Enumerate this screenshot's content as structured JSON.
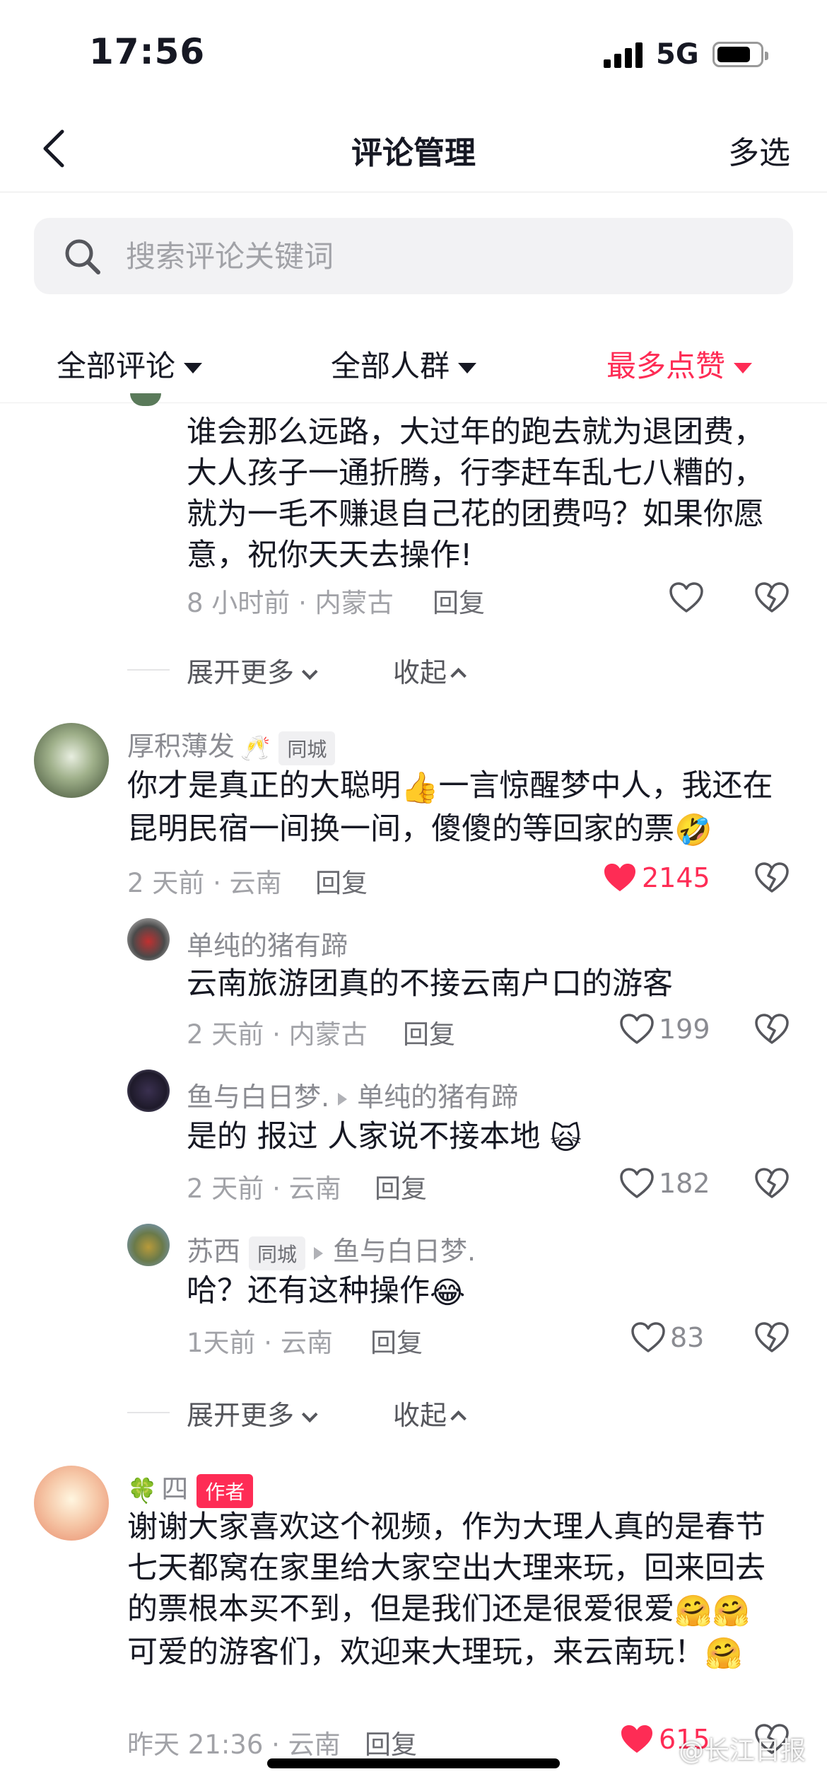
{
  "status_bar": {
    "time": "17:56",
    "network": "5G"
  },
  "header": {
    "title": "评论管理",
    "multi_select": "多选"
  },
  "search": {
    "placeholder": "搜索评论关键词"
  },
  "filters": {
    "all_comments": "全部评论",
    "all_people": "全部人群",
    "most_liked": "最多点赞"
  },
  "colors": {
    "accent": "#fe2c55",
    "text": "#161823",
    "secondary": "#8a8b91"
  },
  "comments": {
    "c0": {
      "text": "谁会那么远路，大过年的跑去就为退团费，大人孩子一通折腾，行李赶车乱七八糟的，就为一毛不赚退自己花的团费吗？如果你愿意，祝你天天去操作!",
      "meta": "8 小时前 · 内蒙古",
      "reply": "回复"
    },
    "expand1": {
      "more": "展开更多",
      "collapse": "收起"
    },
    "c1": {
      "user": "厚积薄发",
      "tag": "同城",
      "text_a": "你才是真正的大聪明",
      "text_b": "一言惊醒梦中人，我还在昆明民宿一间换一间，傻傻的等回家的票",
      "meta": "2 天前 · 云南",
      "reply": "回复",
      "likes": "2145"
    },
    "r1": {
      "user": "单纯的猪有蹄",
      "text": "云南旅游团真的不接云南户口的游客",
      "meta": "2 天前 · 内蒙古",
      "reply": "回复",
      "likes": "199"
    },
    "r2": {
      "user": "鱼与白日梦.",
      "reply_to": "单纯的猪有蹄",
      "text": "是的 报过 人家说不接本地",
      "meta": "2 天前 · 云南",
      "reply": "回复",
      "likes": "182"
    },
    "r3": {
      "user": "苏西",
      "tag": "同城",
      "reply_to": "鱼与白日梦.",
      "text": "哈？还有这种操作",
      "meta": "1天前 · 云南",
      "reply": "回复",
      "likes": "83"
    },
    "expand2": {
      "more": "展开更多",
      "collapse": "收起"
    },
    "c2": {
      "user": "四",
      "tag": "作者",
      "text_a": "谢谢大家喜欢这个视频，作为大理人真的是春节七天都窝在家里给大家空出大理来玩，回来回去的票根本买不到，但是我们还是很爱很爱",
      "text_b": "可爱的游客们，欢迎来大理玩，来云南玩！",
      "meta": "昨天 21:36 · 云南",
      "reply": "回复",
      "likes": "615"
    }
  },
  "watermark": "@长江日报"
}
